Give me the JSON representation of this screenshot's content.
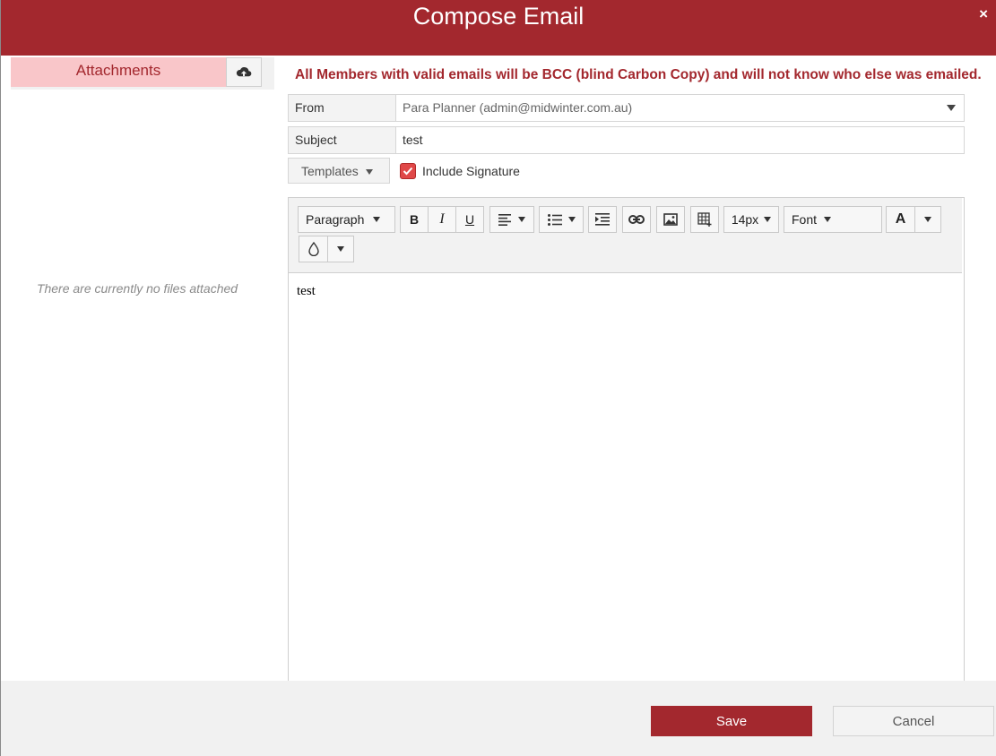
{
  "dialog": {
    "title": "Compose Email",
    "close_label": "×"
  },
  "attachments": {
    "header": "Attachments",
    "upload_icon": "cloud-upload-icon",
    "empty_text": "There are currently no files attached"
  },
  "notice": "All Members with valid emails will be BCC (blind Carbon Copy) and will not know who else was emailed.",
  "form": {
    "from_label": "From",
    "from_value": "Para Planner (admin@midwinter.com.au)",
    "subject_label": "Subject",
    "subject_value": "test",
    "templates_label": "Templates",
    "include_signature_label": "Include Signature",
    "include_signature_checked": true
  },
  "toolbar": {
    "paragraph_label": "Paragraph",
    "bold_label": "B",
    "italic_label": "I",
    "underline_label": "U",
    "font_size_label": "14px",
    "font_label": "Font",
    "text_color_label": "A",
    "icons": [
      "align-left-icon",
      "bullet-list-icon",
      "indent-icon",
      "link-icon",
      "image-icon",
      "table-icon",
      "fill-color-icon"
    ]
  },
  "editor": {
    "content": "test"
  },
  "footer": {
    "save_label": "Save",
    "cancel_label": "Cancel"
  },
  "colors": {
    "brand": "#a3282e",
    "attachments_header_bg": "#f9c6c9"
  }
}
